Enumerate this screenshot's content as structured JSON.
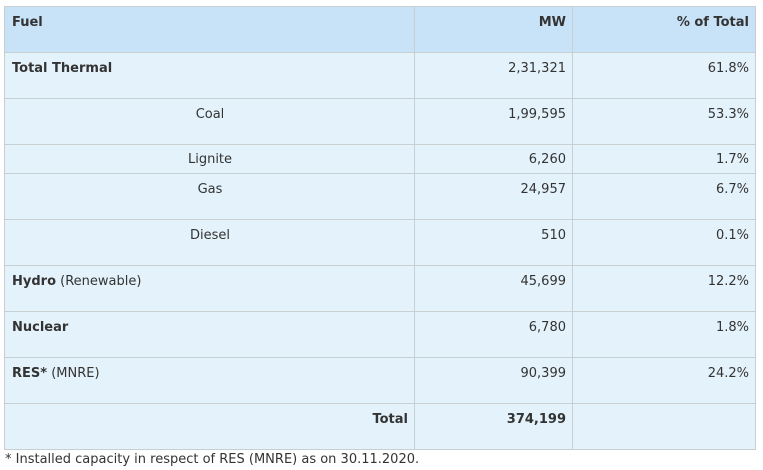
{
  "table": {
    "headers": {
      "fuel": "Fuel",
      "mw": "MW",
      "percent": "% of Total"
    },
    "rows": [
      {
        "fuel": "Total Thermal",
        "qualifier": "",
        "mw": "2,31,321",
        "percent": "61.8%"
      },
      {
        "fuel": "Coal",
        "mw": "1,99,595",
        "percent": "53.3%"
      },
      {
        "fuel": "Lignite",
        "mw": "6,260",
        "percent": "1.7%"
      },
      {
        "fuel": "Gas",
        "mw": "24,957",
        "percent": "6.7%"
      },
      {
        "fuel": "Diesel",
        "mw": "510",
        "percent": "0.1%"
      },
      {
        "fuel": "Hydro",
        "qualifier": "(Renewable)",
        "mw": "45,699",
        "percent": "12.2%"
      },
      {
        "fuel": "Nuclear",
        "qualifier": "",
        "mw": "6,780",
        "percent": "1.8%"
      },
      {
        "fuel": "RES*",
        "qualifier": "(MNRE)",
        "mw": "90,399",
        "percent": "24.2%"
      }
    ],
    "total": {
      "label": "Total",
      "mw": "374,199",
      "percent": ""
    }
  },
  "footnote": "* Installed capacity in respect of RES (MNRE) as on 30.11.2020.",
  "colors": {
    "header_bg": "#c8e3f8",
    "row_bg": "#e4f3fb",
    "border": "#c8cfd3",
    "text": "#333333"
  }
}
